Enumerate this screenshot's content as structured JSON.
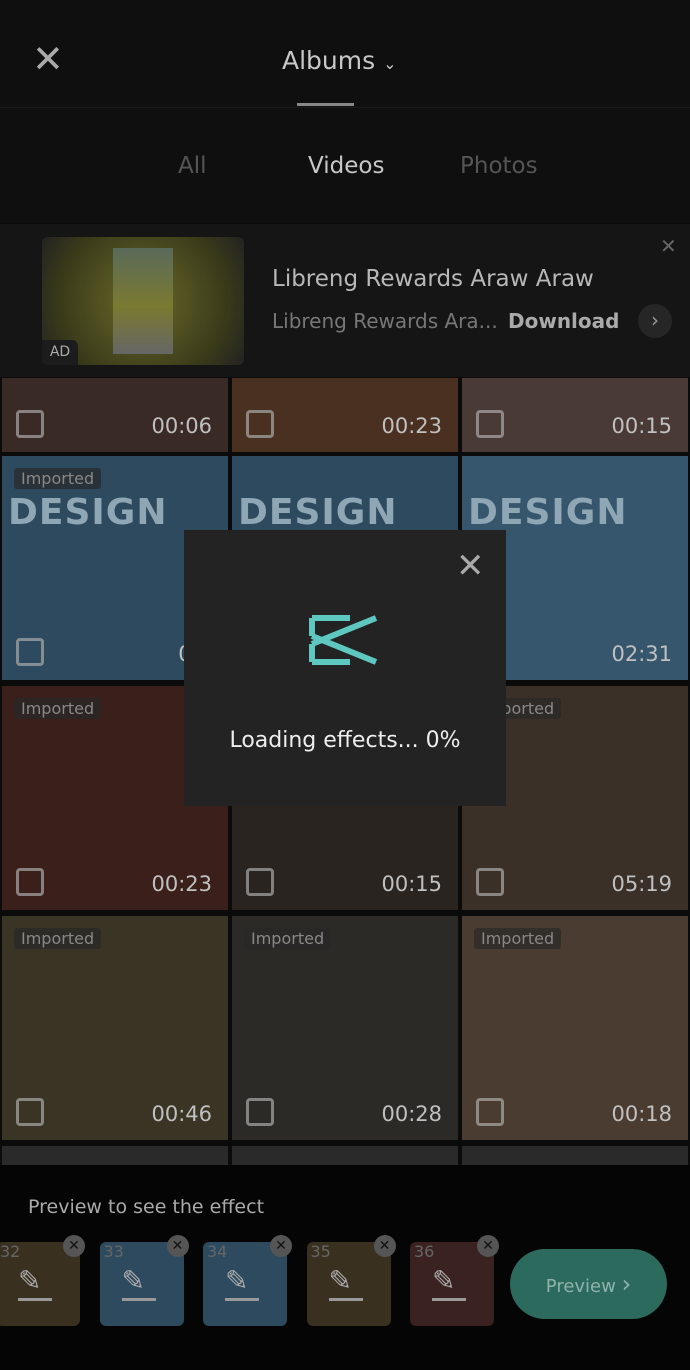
{
  "header": {
    "title": "Albums",
    "tabs": [
      "All",
      "Videos",
      "Photos"
    ],
    "active_tab": "Videos"
  },
  "ad": {
    "badge": "AD",
    "title": "Libreng Rewards Araw Araw",
    "subtitle": "Libreng Rewards Ara...",
    "action": "Download"
  },
  "grid": [
    {
      "dur": "00:06",
      "imp": "",
      "bg": "#3a2a26"
    },
    {
      "dur": "00:23",
      "imp": "",
      "bg": "#4a3020"
    },
    {
      "dur": "00:15",
      "imp": "",
      "bg": "#4a3a36"
    },
    {
      "dur": "00:",
      "imp": "Imported",
      "bg": "#2e4a5e",
      "design": "DESIGN"
    },
    {
      "dur": "",
      "imp": "",
      "bg": "#2e4a5e",
      "design": "DESIGN"
    },
    {
      "dur": "02:31",
      "imp": "",
      "bg": "#35566c",
      "design": "DESIGN"
    },
    {
      "dur": "00:23",
      "imp": "Imported",
      "bg": "#3a1f1a"
    },
    {
      "dur": "00:15",
      "imp": "",
      "bg": "#2a2420"
    },
    {
      "dur": "05:19",
      "imp": "Imported",
      "bg": "#3a3028"
    },
    {
      "dur": "00:46",
      "imp": "Imported",
      "bg": "#3a3424"
    },
    {
      "dur": "00:28",
      "imp": "Imported",
      "bg": "#2c2a26"
    },
    {
      "dur": "00:18",
      "imp": "Imported",
      "bg": "#4a3c30"
    }
  ],
  "dialog": {
    "loading_text": "Loading effects... 0%",
    "progress_percent": 0
  },
  "bottom": {
    "hint": "Preview to see the effect",
    "selected": [
      {
        "n": "32",
        "bg": "#3a3020"
      },
      {
        "n": "33",
        "bg": "#2e4a5e"
      },
      {
        "n": "34",
        "bg": "#2e4a5e"
      },
      {
        "n": "35",
        "bg": "#3a3020"
      },
      {
        "n": "36",
        "bg": "#3a2220"
      }
    ],
    "preview_label": "Preview"
  },
  "colors": {
    "accent": "#2c6a5e",
    "logo": "#5ec8c0"
  }
}
